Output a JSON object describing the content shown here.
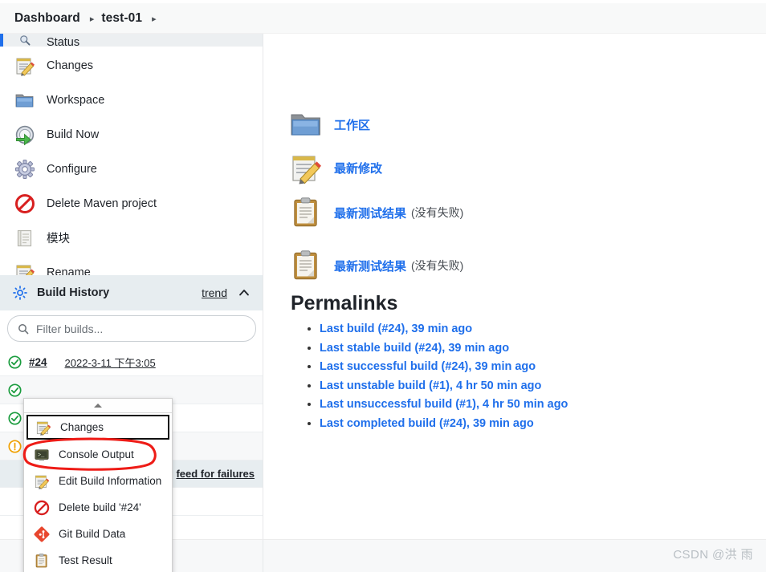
{
  "breadcrumb": {
    "items": [
      {
        "label": "Dashboard"
      },
      {
        "label": "test-01"
      }
    ],
    "separator": "▸"
  },
  "sidebar": {
    "tasks": [
      {
        "label": "Status",
        "icon": "magnifier-icon",
        "selected": true
      },
      {
        "label": "Changes",
        "icon": "notepad-pencil-icon",
        "selected": false
      },
      {
        "label": "Workspace",
        "icon": "folder-icon",
        "selected": false
      },
      {
        "label": "Build Now",
        "icon": "build-now-icon",
        "selected": false
      },
      {
        "label": "Configure",
        "icon": "gear-icon",
        "selected": false
      },
      {
        "label": "Delete Maven project",
        "icon": "delete-icon",
        "selected": false
      },
      {
        "label": "模块",
        "icon": "module-icon",
        "selected": false
      },
      {
        "label": "Rename",
        "icon": "notepad-pencil-icon",
        "selected": false
      }
    ],
    "build_history": {
      "title": "Build History",
      "icon": "build-history-icon",
      "trend_label": "trend",
      "collapse_icon": "chevron-up-icon",
      "filter_placeholder": "Filter builds...",
      "filter_value": "",
      "filter_icon": "search-icon",
      "rows": [
        {
          "status": "success",
          "number": "#24",
          "time": "2022-3-11 下午3:05"
        },
        {
          "status": "success",
          "number": "",
          "time": ""
        },
        {
          "status": "success",
          "number": "",
          "time": ""
        },
        {
          "status": "unstable",
          "number": "",
          "time": ""
        }
      ],
      "feed_link": "feed for failures"
    }
  },
  "context_menu": {
    "items": [
      {
        "label": "Changes",
        "icon": "notepad-pencil-icon",
        "focused": true
      },
      {
        "label": "Console Output",
        "icon": "console-icon",
        "focused": false
      },
      {
        "label": "Edit Build Information",
        "icon": "notepad-pencil-icon",
        "focused": false
      },
      {
        "label": "Delete build '#24'",
        "icon": "delete-icon",
        "focused": false
      },
      {
        "label": "Git Build Data",
        "icon": "git-icon",
        "focused": false
      },
      {
        "label": "Test Result",
        "icon": "clipboard-icon",
        "focused": false
      }
    ],
    "annotation_color": "#ee1c17"
  },
  "main": {
    "links": [
      {
        "label": "工作区",
        "icon": "folder-icon",
        "suffix": ""
      },
      {
        "label": "最新修改",
        "icon": "notepad-pencil-icon",
        "suffix": ""
      },
      {
        "label": "最新测试结果",
        "icon": "clipboard-icon",
        "suffix": "(没有失败)"
      },
      {
        "label": "最新测试结果",
        "icon": "clipboard-icon",
        "suffix": "(没有失败)"
      }
    ],
    "permalinks_heading": "Permalinks",
    "permalinks": [
      {
        "label": "Last build (#24), 39 min ago"
      },
      {
        "label": "Last stable build (#24), 39 min ago"
      },
      {
        "label": "Last successful build (#24), 39 min ago"
      },
      {
        "label": "Last unstable build (#1), 4 hr 50 min ago"
      },
      {
        "label": "Last unsuccessful build (#1), 4 hr 50 min ago"
      },
      {
        "label": "Last completed build (#24), 39 min ago"
      }
    ]
  },
  "watermark": {
    "text": "CSDN @洪 雨"
  },
  "colors": {
    "link": "#1f6feb",
    "success": "#1a9c3e",
    "unstable": "#f0a000",
    "annotation": "#ee1c17",
    "selected_bg": "#eceff1"
  }
}
